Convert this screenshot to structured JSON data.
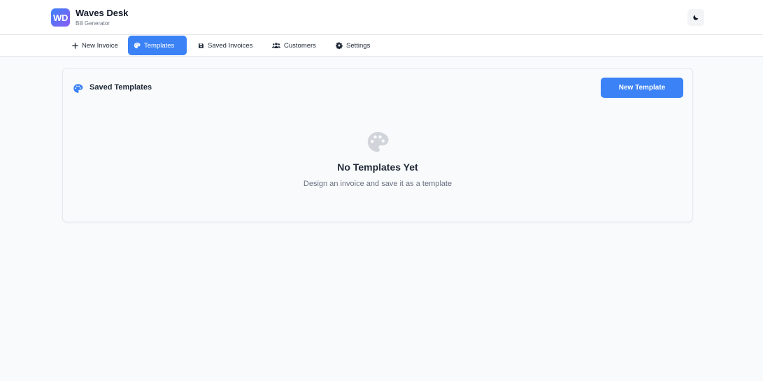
{
  "app": {
    "logo_initials": "WD",
    "title": "Waves Desk",
    "subtitle": "Bill Generator",
    "theme_toggle_icon": "moon-icon"
  },
  "nav": {
    "tabs": [
      {
        "label": "New Invoice",
        "icon": "plus-icon",
        "active": false
      },
      {
        "label": "Templates",
        "icon": "palette-icon",
        "active": true
      },
      {
        "label": "Saved Invoices",
        "icon": "save-icon",
        "active": false
      },
      {
        "label": "Customers",
        "icon": "users-icon",
        "active": false
      },
      {
        "label": "Settings",
        "icon": "gear-icon",
        "active": false
      }
    ]
  },
  "templates_panel": {
    "title": "Saved Templates",
    "new_button_label": "New Template",
    "empty_state": {
      "title": "No Templates Yet",
      "message": "Design an invoice and save it as a template"
    }
  },
  "colors": {
    "accent": "#3b82f6",
    "logo_gradient_start": "#3b82f6",
    "logo_gradient_end": "#8b5cf6",
    "empty_icon": "#d1d5db"
  }
}
